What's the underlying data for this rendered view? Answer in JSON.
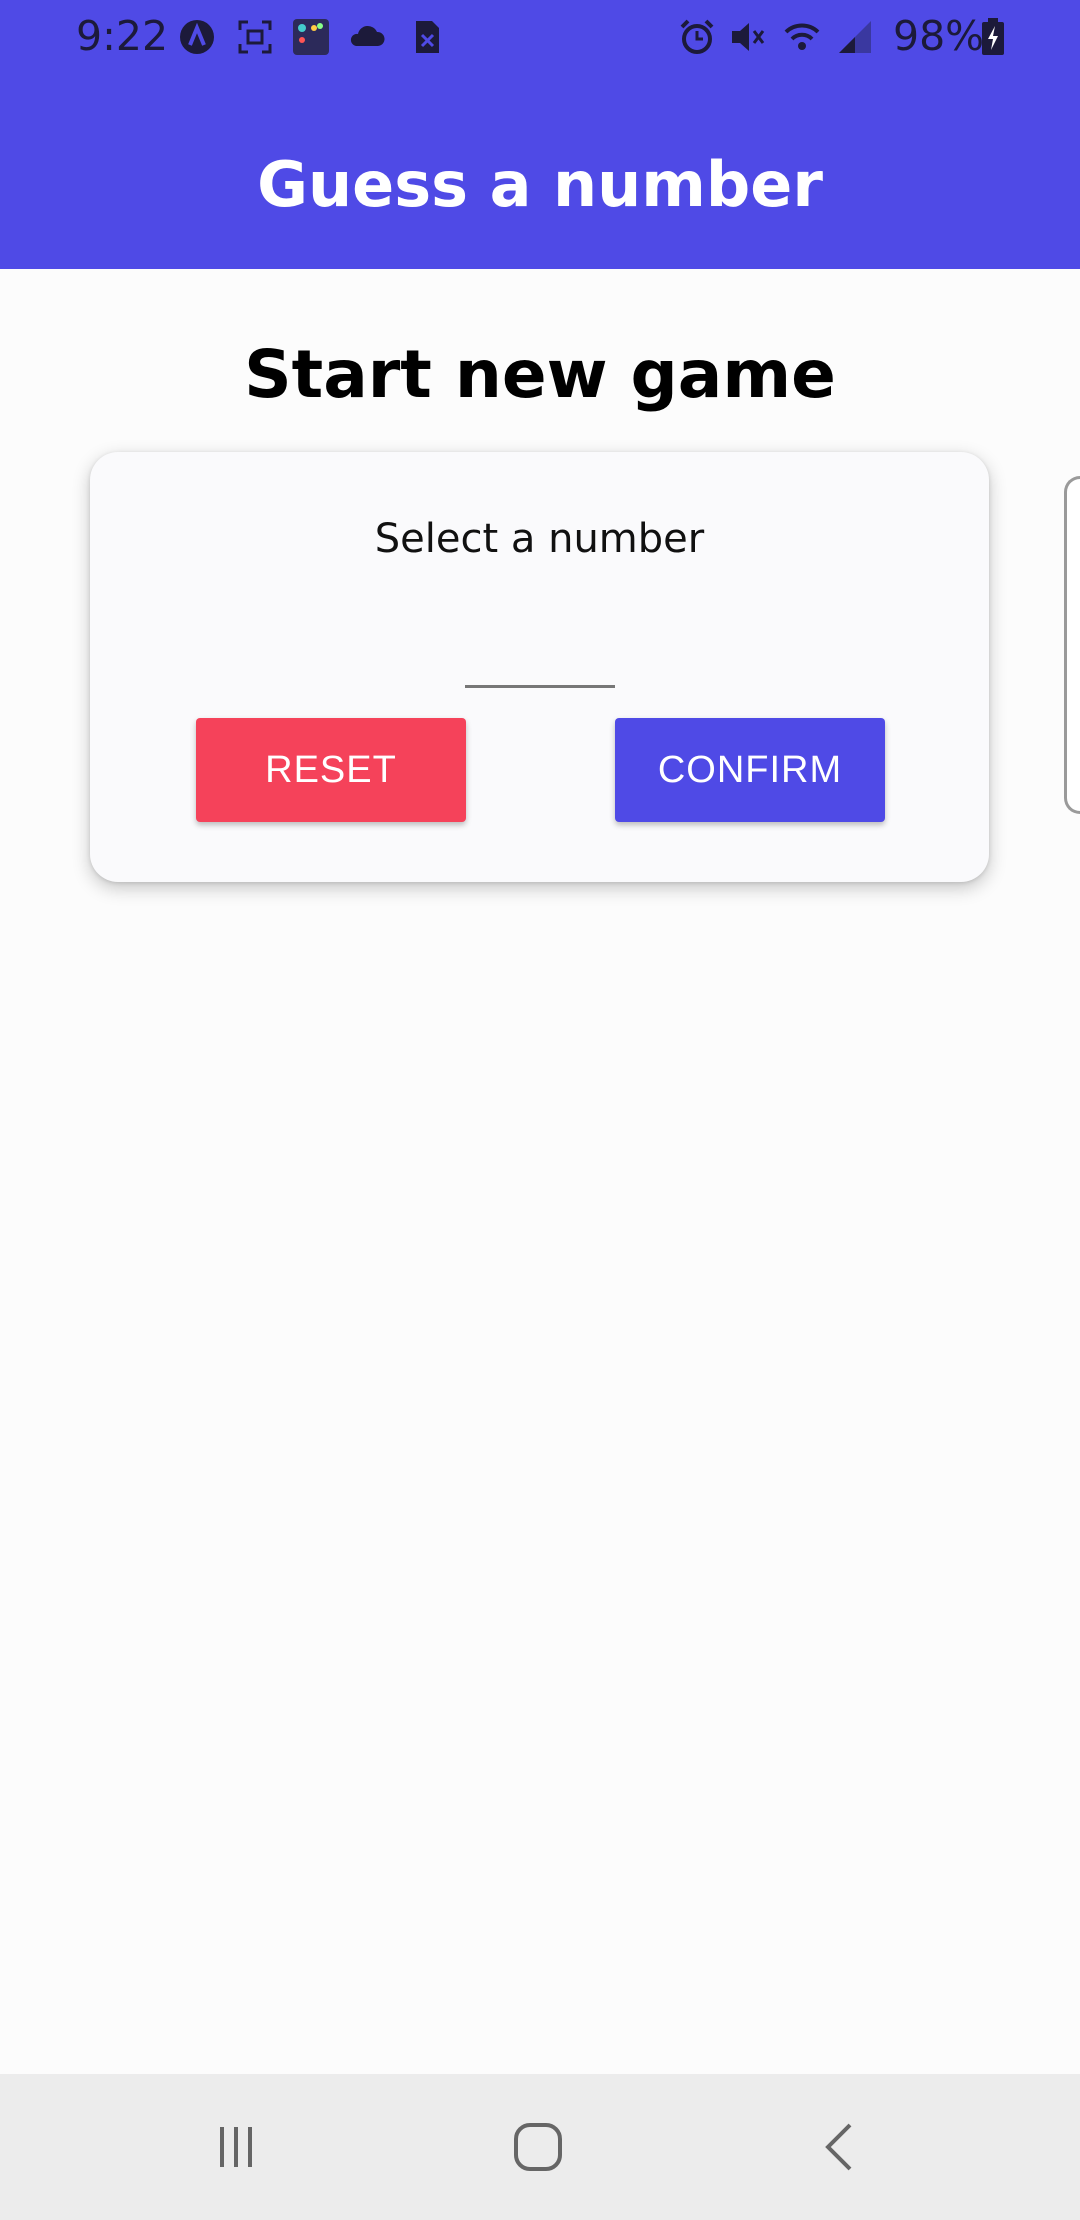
{
  "status_bar": {
    "time": "9:22",
    "battery": "98%",
    "icons": [
      "app-a-icon",
      "screenshot-icon",
      "app-grid-icon",
      "cloud-icon",
      "file-icon",
      "alarm-icon",
      "mute-icon",
      "wifi-icon",
      "signal-icon",
      "battery-charging-icon"
    ]
  },
  "app_bar": {
    "title": "Guess a number"
  },
  "screen": {
    "title": "Start new game",
    "card": {
      "label": "Select a number",
      "input_value": "",
      "reset_label": "RESET",
      "confirm_label": "CONFIRM"
    }
  },
  "colors": {
    "primary": "#4f4ae6",
    "reset": "#f5425a",
    "background": "#fcfcfc"
  },
  "nav_bar": {
    "icons": [
      "recent-apps-icon",
      "home-icon",
      "back-icon"
    ]
  }
}
